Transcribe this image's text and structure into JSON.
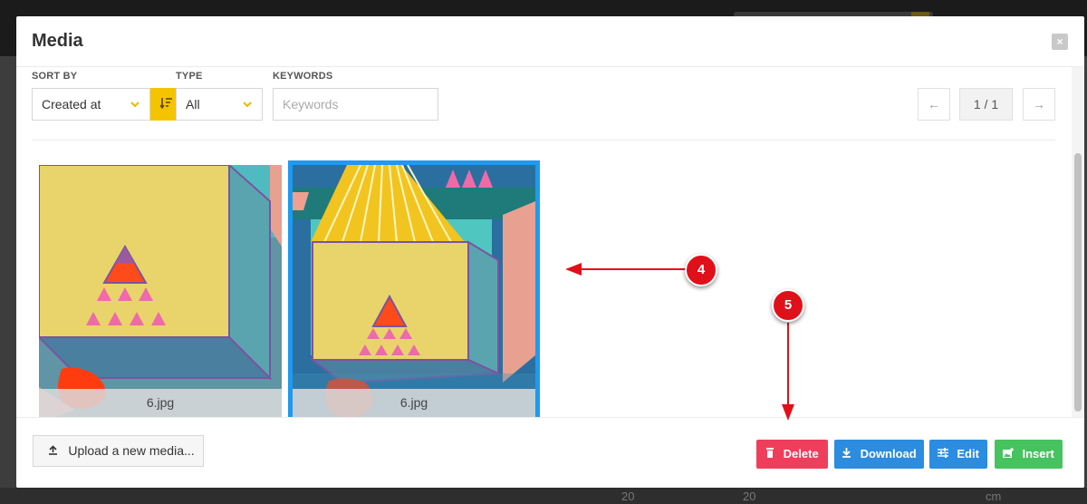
{
  "modal": {
    "title": "Media",
    "close_label": "×"
  },
  "filters": {
    "sort_by_label": "SORT BY",
    "sort_value": "Created at",
    "type_label": "TYPE",
    "type_value": "All",
    "keywords_label": "KEYWORDS",
    "keywords_placeholder": "Keywords",
    "keywords_value": ""
  },
  "pagination": {
    "prev_label": "←",
    "info": "1 / 1",
    "next_label": "→"
  },
  "gallery": {
    "items": [
      {
        "filename": "6.jpg",
        "selected": false
      },
      {
        "filename": "6.jpg",
        "selected": true
      }
    ]
  },
  "footer": {
    "upload_label": "Upload a new media...",
    "delete_label": "Delete",
    "download_label": "Download",
    "edit_label": "Edit",
    "insert_label": "Insert"
  },
  "annotations": {
    "callout_4": "4",
    "callout_5": "5"
  },
  "background": {
    "row_values": [
      "20",
      "20",
      "cm"
    ]
  },
  "colors": {
    "accent_yellow": "#f5c400",
    "selection_blue": "#1e9af0",
    "delete_red": "#ef3e5c",
    "download_blue": "#2b8ce0",
    "edit_blue": "#2b8ce0",
    "insert_green": "#46c35f",
    "annotation_red": "#e0101a"
  },
  "icons": {
    "close": "close-icon",
    "sort_direction": "sort-icon",
    "chevron": "chevron-down-icon",
    "upload": "upload-icon",
    "delete": "trash-icon",
    "download": "download-icon",
    "edit": "sliders-icon",
    "insert": "image-add-icon"
  }
}
